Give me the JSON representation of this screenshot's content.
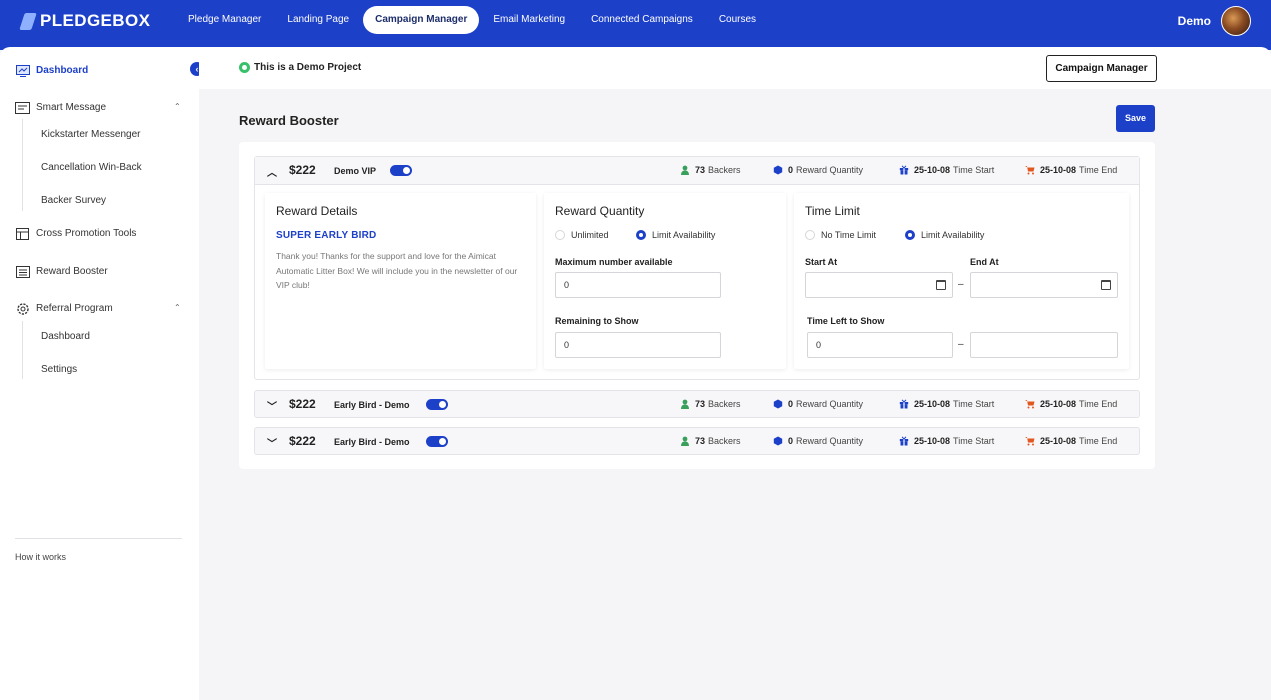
{
  "topbar": {
    "logo": "PLEDGEBOX",
    "nav": [
      "Pledge Manager",
      "Landing Page",
      "Campaign Manager",
      "Email Marketing",
      "Connected Campaigns",
      "Courses"
    ],
    "active_nav": "Campaign Manager",
    "user_name": "Demo"
  },
  "sidebar": {
    "items": {
      "dashboard": "Dashboard",
      "smart_message": "Smart Message",
      "kickstarter_messenger": "Kickstarter Messenger",
      "cancellation_winback": "Cancellation Win-Back",
      "backer_survey": "Backer Survey",
      "cross_promotion": "Cross Promotion Tools",
      "reward_booster": "Reward Booster",
      "referral_program": "Referral Program",
      "referral_dashboard": "Dashboard",
      "referral_settings": "Settings"
    },
    "how_it_works": "How it  works"
  },
  "header": {
    "demo_label": "This is a Demo Project",
    "campaign_manager_button": "Campaign Manager"
  },
  "page": {
    "title": "Reward Booster",
    "save_label": "Save"
  },
  "rewards": [
    {
      "price": "$222",
      "name": "Demo VIP",
      "enabled": true,
      "expanded": true,
      "backers_count": "73",
      "backers_label": "Backers",
      "quantity_count": "0",
      "quantity_label": "Reward Quantity",
      "start_date": "25-10-08",
      "start_label": "Time Start",
      "end_date": "25-10-08",
      "end_label": "Time End"
    },
    {
      "price": "$222",
      "name": "Early Bird - Demo",
      "enabled": true,
      "expanded": false,
      "backers_count": "73",
      "backers_label": "Backers",
      "quantity_count": "0",
      "quantity_label": "Reward Quantity",
      "start_date": "25-10-08",
      "start_label": "Time Start",
      "end_date": "25-10-08",
      "end_label": "Time End"
    },
    {
      "price": "$222",
      "name": "Early Bird - Demo",
      "enabled": true,
      "expanded": false,
      "backers_count": "73",
      "backers_label": "Backers",
      "quantity_count": "0",
      "quantity_label": "Reward Quantity",
      "start_date": "25-10-08",
      "start_label": "Time Start",
      "end_date": "25-10-08",
      "end_label": "Time End"
    }
  ],
  "details": {
    "reward_details_title": "Reward Details",
    "reward_name": "SUPER EARLY BIRD",
    "reward_description": "Thank you! Thanks for the support and love for the Aimicat Automatic Litter Box! We will include you in the newsletter of our VIP club!",
    "reward_quantity_title": "Reward Quantity",
    "qty_option_unlimited": "Unlimited",
    "qty_option_limit": "Limit Availability",
    "qty_selected": "Limit Availability",
    "max_label": "Maximum number available",
    "max_value": "0",
    "remaining_label": "Remaining to Show",
    "remaining_value": "0",
    "time_limit_title": "Time Limit",
    "time_option_none": "No Time Limit",
    "time_option_limit": "Limit Availability",
    "time_selected": "Limit Availability",
    "start_at_label": "Start At",
    "start_at_value": "",
    "end_at_label": "End At",
    "end_at_value": "",
    "time_left_label": "Time Left to Show",
    "time_left_value": "0",
    "time_left_unit_value": ""
  },
  "colors": {
    "brand": "#1d40c9",
    "backers_icon": "#38a05a",
    "quantity_icon": "#1d40c9",
    "start_icon": "#1d40c9",
    "end_icon": "#e2571f",
    "demo_dot": "#38c06a"
  }
}
